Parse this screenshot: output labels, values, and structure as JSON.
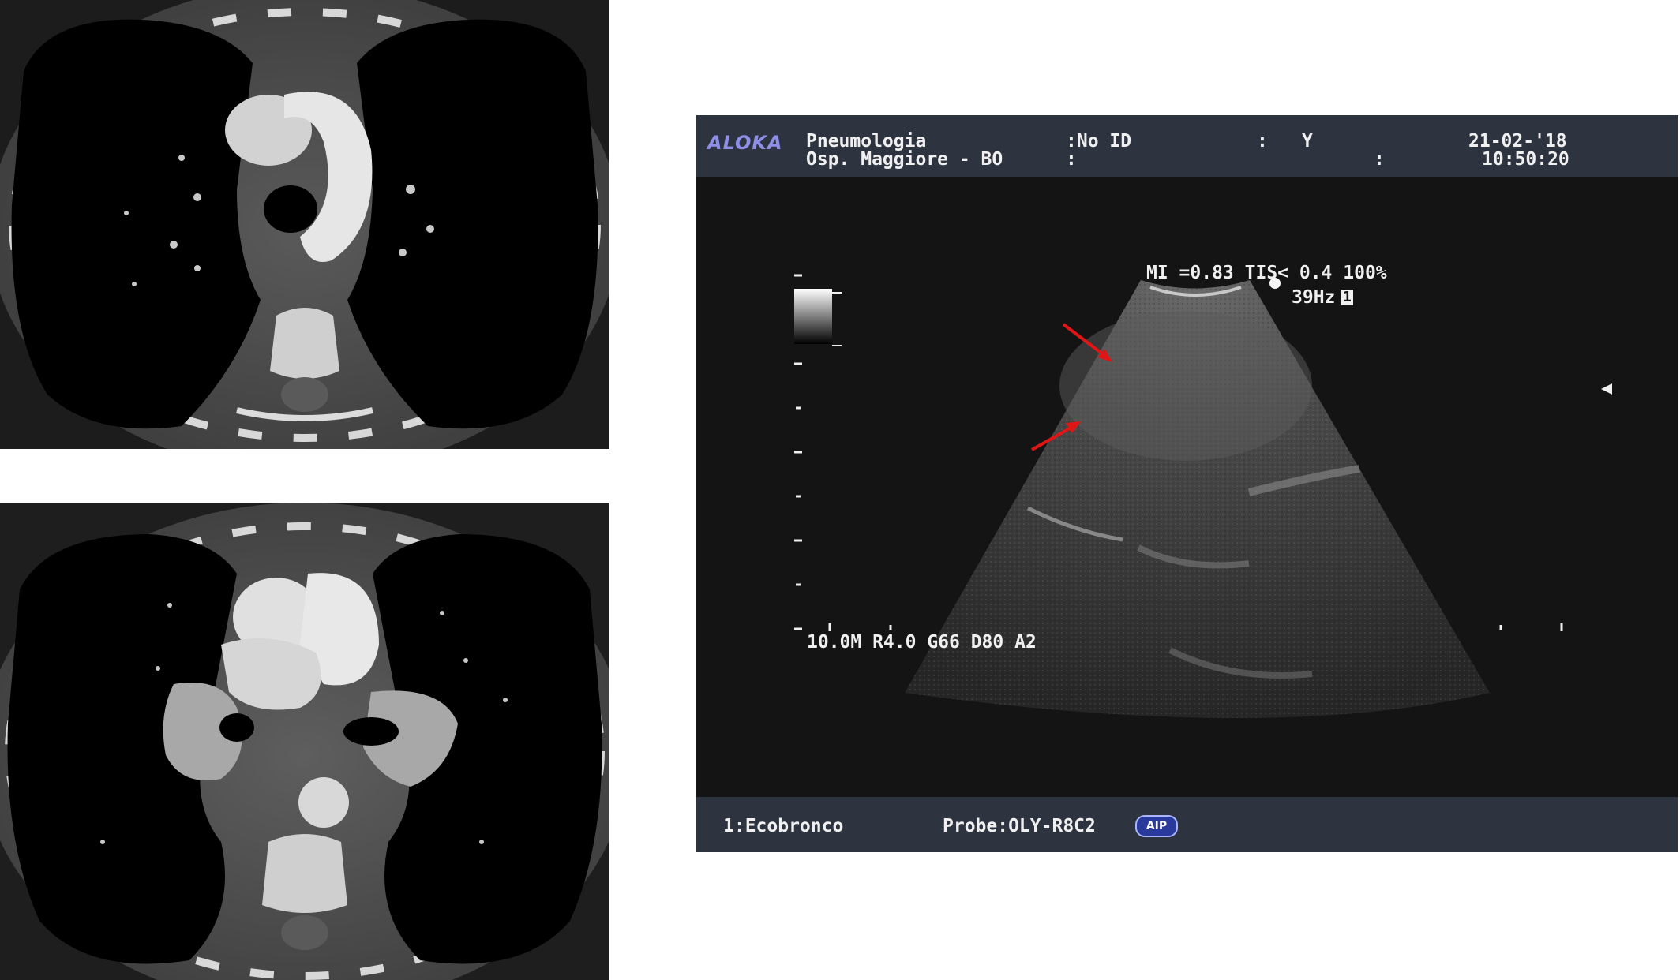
{
  "ultrasound": {
    "brand": "ALOKA",
    "header": {
      "dept": "Pneumologia",
      "hospital": "Osp. Maggiore - BO",
      "id_field": ":No ID",
      "colon2": ":",
      "colon3": ":",
      "y_label": "Y",
      "colon4": ":",
      "date": "21-02-'18",
      "time": "10:50:20"
    },
    "readouts": {
      "mi_tis": "MI =0.83 TIS< 0.4 100%",
      "framerate": "39Hz",
      "frame_marker": "1",
      "params": "10.0M R4.0 G66 D80 A2"
    },
    "footer": {
      "mode": "1:Ecobronco",
      "probe": "Probe:OLY-R8C2",
      "badge": "AIP"
    },
    "colors": {
      "header_bg": "#2e3340",
      "screen_bg": "#141414",
      "brand": "#8f8fe8",
      "arrow": "#e01515"
    }
  },
  "images": {
    "ct_top": "axial chest CT at aortic arch level",
    "ct_bottom": "axial chest CT at pulmonary artery level with hilar soft tissue mass"
  }
}
